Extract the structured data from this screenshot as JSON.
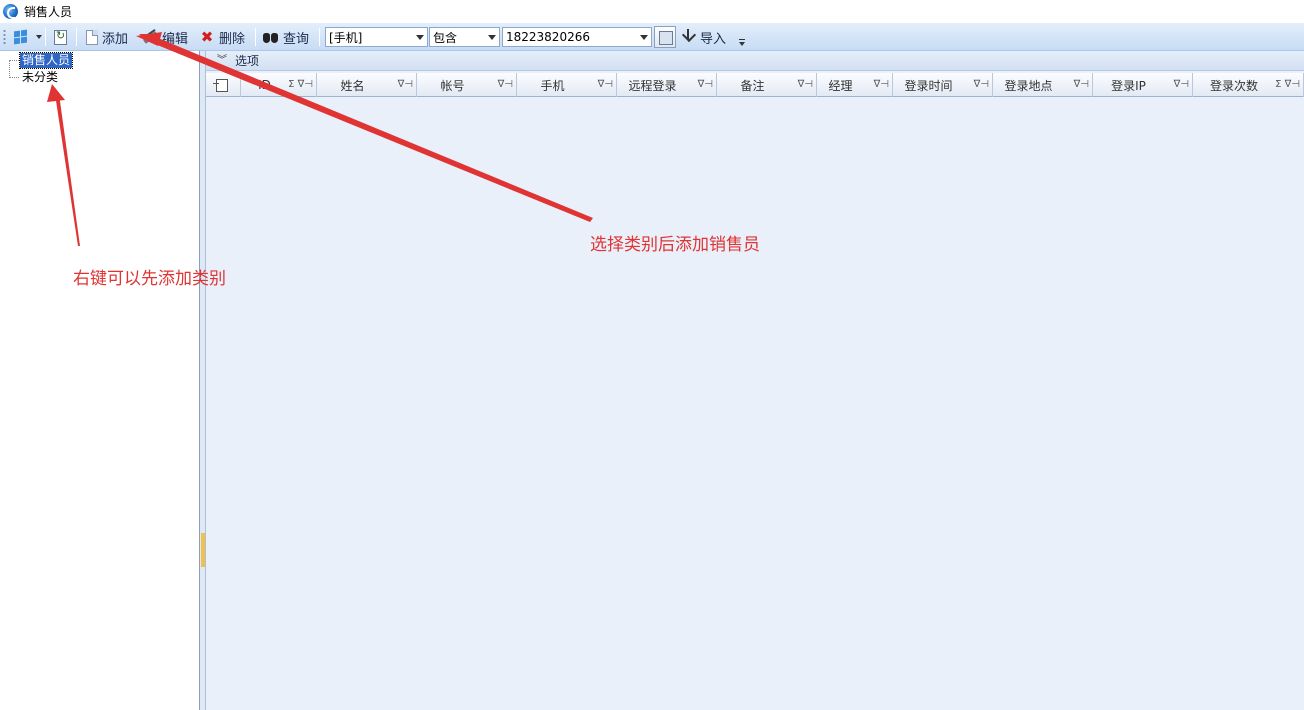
{
  "window": {
    "title": "销售人员"
  },
  "toolbar": {
    "add_label": "添加",
    "edit_label": "编辑",
    "delete_label": "删除",
    "query_label": "查询",
    "field_select": "[手机]",
    "operator_select": "包含",
    "search_value": "18223820266",
    "import_label": "导入"
  },
  "tree": {
    "items": [
      {
        "label": "销售人员",
        "selected": true
      },
      {
        "label": "未分类",
        "selected": false
      }
    ]
  },
  "group_bar": {
    "label": "选项"
  },
  "grid": {
    "columns": [
      {
        "label": "ID",
        "icons": "Σ ∇⊣"
      },
      {
        "label": "姓名",
        "icons": "∇⊣"
      },
      {
        "label": "帐号",
        "icons": "∇⊣"
      },
      {
        "label": "手机",
        "icons": "∇⊣"
      },
      {
        "label": "远程登录",
        "icons": "∇⊣"
      },
      {
        "label": "备注",
        "icons": "∇⊣"
      },
      {
        "label": "经理",
        "icons": "∇⊣"
      },
      {
        "label": "登录时间",
        "icons": "∇⊣"
      },
      {
        "label": "登录地点",
        "icons": "∇⊣"
      },
      {
        "label": "登录IP",
        "icons": "∇⊣"
      },
      {
        "label": "登录次数",
        "icons": "Σ ∇⊣"
      }
    ]
  },
  "annotations": {
    "right_click_note": "右键可以先添加类别",
    "add_note": "选择类别后添加销售员",
    "color": "#e03434"
  }
}
